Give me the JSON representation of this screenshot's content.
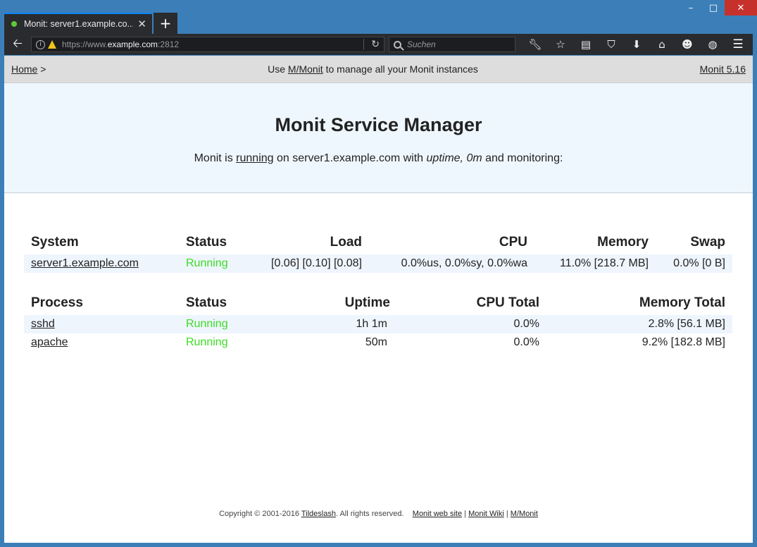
{
  "window": {
    "controls": {
      "minimize": "–",
      "maximize": "□",
      "close": "✕"
    }
  },
  "tab": {
    "title": "Monit: server1.example.co...",
    "close": "✕",
    "new": "+"
  },
  "navbar": {
    "back": "🡠",
    "url_prefix": "https://www.",
    "url_host": "example.com",
    "url_port": ":2812",
    "reload": "↻",
    "search_placeholder": "Suchen",
    "icons": [
      "wrench-icon",
      "star-icon",
      "reader-icon",
      "pocket-icon",
      "download-icon",
      "home-icon",
      "emoji-icon",
      "globe-icon"
    ],
    "menu": "☰"
  },
  "topnav": {
    "home": "Home",
    "home_sep": " >",
    "center_pre": "Use ",
    "center_link": "M/Monit",
    "center_post": " to manage all your Monit instances",
    "version": "Monit 5.16"
  },
  "hero": {
    "title": "Monit Service Manager",
    "pre": "Monit is ",
    "running": "running",
    "mid": " on server1.example.com with ",
    "uptime": "uptime, 0m",
    "post": "  and monitoring:"
  },
  "system_table": {
    "headers": [
      "System",
      "Status",
      "Load",
      "CPU",
      "Memory",
      "Swap"
    ],
    "rows": [
      {
        "name": "server1.example.com",
        "status": "Running",
        "load": "[0.06] [0.10] [0.08]",
        "cpu": "0.0%us, 0.0%sy, 0.0%wa",
        "memory": "11.0% [218.7 MB]",
        "swap": "0.0% [0 B]"
      }
    ]
  },
  "process_table": {
    "headers": [
      "Process",
      "Status",
      "Uptime",
      "CPU Total",
      "Memory Total"
    ],
    "rows": [
      {
        "name": "sshd",
        "status": "Running",
        "uptime": "1h 1m",
        "cpu": "0.0%",
        "memory": "2.8% [56.1 MB]"
      },
      {
        "name": "apache",
        "status": "Running",
        "uptime": "50m",
        "cpu": "0.0%",
        "memory": "9.2% [182.8 MB]"
      }
    ]
  },
  "footer": {
    "copyright": "Copyright © 2001-2016 ",
    "tildeslash": "Tildeslash",
    "rights": ". All rights reserved.",
    "link1": "Monit web site",
    "link2": "Monit Wiki",
    "link3": "M/Monit",
    "sep": " | "
  },
  "colors": {
    "running": "#3cdc24",
    "hero_bg": "#eff7fe",
    "topnav_bg": "#dddddd"
  }
}
